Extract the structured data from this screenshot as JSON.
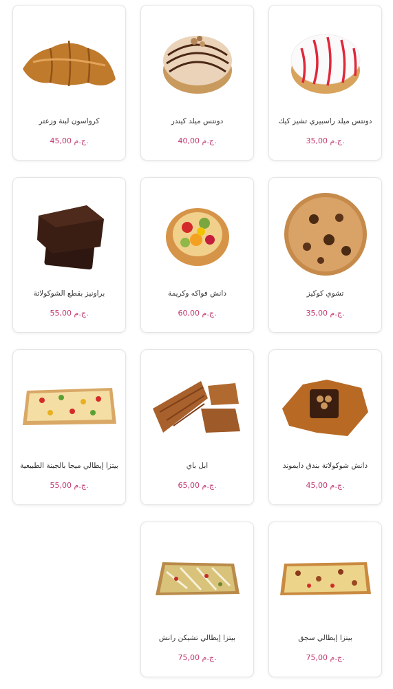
{
  "currency_label": "ج.م.",
  "products": [
    {
      "name": "دونتس ميلد راسبيري تشيز كيك",
      "price": "35,00",
      "icon": "raspberry-donut"
    },
    {
      "name": "دونتس ميلد كيندر",
      "price": "40,00",
      "icon": "kinder-donut"
    },
    {
      "name": "كرواسون لبنة وزعتر",
      "price": "45,00",
      "icon": "croissant"
    },
    {
      "name": "تشوي كوكيز",
      "price": "35,00",
      "icon": "cookie"
    },
    {
      "name": "دانش فواكه وكريمة",
      "price": "60,00",
      "icon": "fruit-tart"
    },
    {
      "name": "براونيز بقطع الشوكولاتة",
      "price": "55,00",
      "icon": "brownie"
    },
    {
      "name": "دانش شوكولاتة بندق دايموند",
      "price": "45,00",
      "icon": "choco-danish"
    },
    {
      "name": "ابل باي",
      "price": "65,00",
      "icon": "apple-pie"
    },
    {
      "name": "بيتزا إيطالي ميجا بالجبنة الطبيعية",
      "price": "55,00",
      "icon": "pizza-square"
    },
    {
      "name": "بيتزا إيطالي سجق",
      "price": "75,00",
      "icon": "pizza-sausage"
    },
    {
      "name": "بيتزا إيطالي تشيكن رانش",
      "price": "75,00",
      "icon": "pizza-chicken"
    }
  ]
}
